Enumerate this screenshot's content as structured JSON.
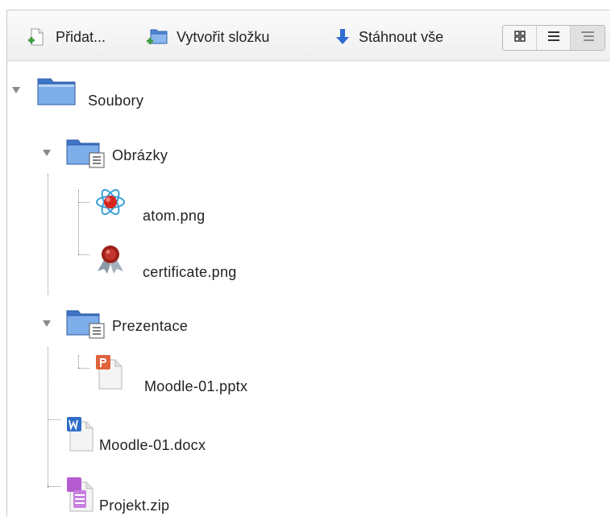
{
  "toolbar": {
    "add_label": "Přidat...",
    "mkdir_label": "Vytvořit složku",
    "download_label": "Stáhnout vše",
    "view_modes": [
      "icons-view",
      "list-view",
      "tree-view"
    ]
  },
  "tree": {
    "root": {
      "name": "Soubory"
    },
    "folders": [
      {
        "name": "Obrázky",
        "files": [
          "atom.png",
          "certificate.png"
        ]
      },
      {
        "name": "Prezentace",
        "files": [
          "Moodle-01.pptx"
        ]
      }
    ],
    "root_files": [
      "Moodle-01.docx",
      "Projekt.zip"
    ]
  },
  "colors": {
    "folder_blue": "#5b8fd8",
    "download_arrow": "#2f6bd1",
    "ppt_orange": "#e0633c",
    "word_blue": "#2d6cc9",
    "zip_purple": "#b55bd0"
  }
}
